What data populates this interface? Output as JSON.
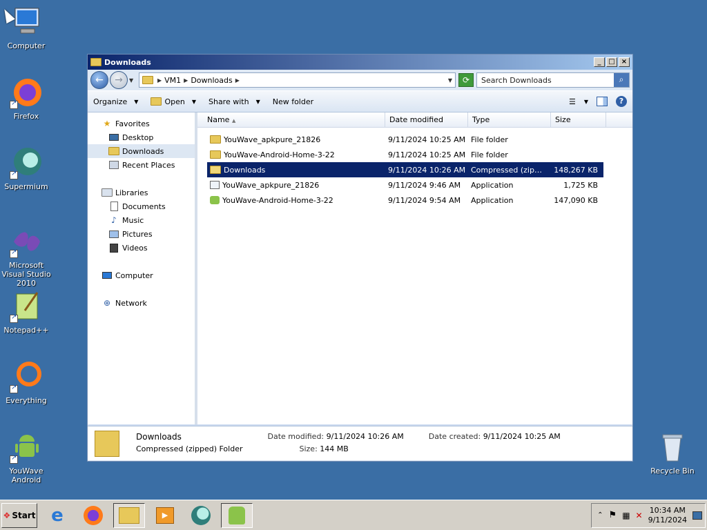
{
  "desktop": {
    "icons": [
      {
        "label": "Computer"
      },
      {
        "label": "Firefox"
      },
      {
        "label": "Supermium"
      },
      {
        "label": "Microsoft Visual Studio 2010"
      },
      {
        "label": "Notepad++"
      },
      {
        "label": "Everything"
      },
      {
        "label": "YouWave Android"
      },
      {
        "label": "Recycle Bin"
      }
    ]
  },
  "window": {
    "title": "Downloads",
    "address": {
      "crumbs": [
        "VM1",
        "Downloads"
      ]
    },
    "search_placeholder": "Search Downloads",
    "toolbar": {
      "organize": "Organize",
      "open": "Open",
      "share_with": "Share with",
      "new_folder": "New folder"
    },
    "nav": {
      "favorites": "Favorites",
      "desktop": "Desktop",
      "downloads": "Downloads",
      "recent_places": "Recent Places",
      "libraries": "Libraries",
      "documents": "Documents",
      "music": "Music",
      "pictures": "Pictures",
      "videos": "Videos",
      "computer": "Computer",
      "network": "Network"
    },
    "columns": {
      "name": "Name",
      "date": "Date modified",
      "type": "Type",
      "size": "Size"
    },
    "files": [
      {
        "name": "YouWave_apkpure_21826",
        "date": "9/11/2024 10:25 AM",
        "type": "File folder",
        "size": ""
      },
      {
        "name": "YouWave-Android-Home-3-22",
        "date": "9/11/2024 10:25 AM",
        "type": "File folder",
        "size": ""
      },
      {
        "name": "Downloads",
        "date": "9/11/2024 10:26 AM",
        "type": "Compressed (zippe...",
        "size": "148,267 KB"
      },
      {
        "name": "YouWave_apkpure_21826",
        "date": "9/11/2024 9:46 AM",
        "type": "Application",
        "size": "1,725 KB"
      },
      {
        "name": "YouWave-Android-Home-3-22",
        "date": "9/11/2024 9:54 AM",
        "type": "Application",
        "size": "147,090 KB"
      }
    ],
    "details": {
      "name": "Downloads",
      "kind": "Compressed (zipped) Folder",
      "modified_label": "Date modified:",
      "modified_value": "9/11/2024 10:26 AM",
      "size_label": "Size:",
      "size_value": "144 MB",
      "created_label": "Date created:",
      "created_value": "9/11/2024 10:25 AM"
    }
  },
  "taskbar": {
    "start": "Start",
    "time": "10:34 AM",
    "date": "9/11/2024"
  }
}
